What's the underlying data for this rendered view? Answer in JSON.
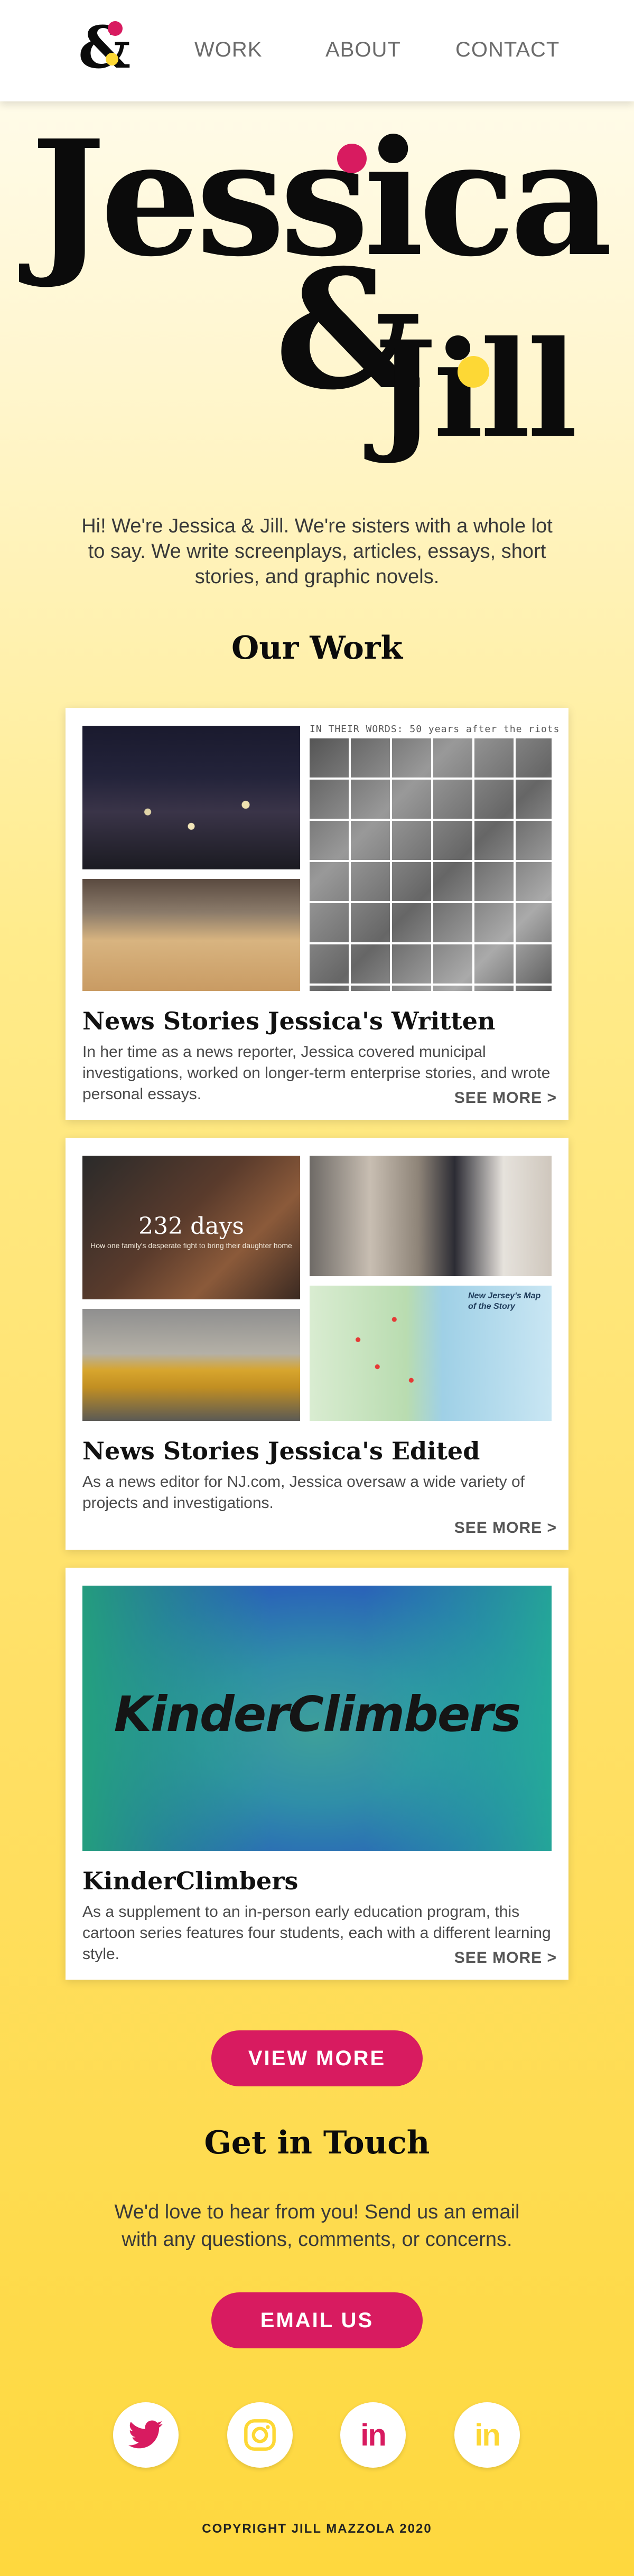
{
  "nav": {
    "logo_alt": "&J",
    "links": [
      "WORK",
      "ABOUT",
      "CONTACT"
    ]
  },
  "hero": {
    "line1": "Jessica",
    "amp": "&",
    "line2": "Jill",
    "intro": "Hi! We're Jessica & Jill. We're sisters with a whole lot to say. We write screenplays, articles, essays, short stories, and graphic novels."
  },
  "our_work": {
    "title": "Our Work",
    "cards": [
      {
        "image_caption": "IN THEIR WORDS: 50 years after the riots",
        "title": "News Stories Jessica's Written",
        "desc": "In her time as a news reporter, Jessica covered municipal investigations, worked on longer-term enterprise stories, and wrote personal essays.",
        "link": "SEE MORE >"
      },
      {
        "image_caption": "232 days",
        "image_subcaption": "How one family's desperate fight to bring their daughter home",
        "map_caption": "New Jersey's Map of the Story",
        "title": "News Stories Jessica's Edited",
        "desc": "As a news editor for NJ.com, Jessica oversaw a wide variety of projects and investigations.",
        "link": "SEE MORE >"
      },
      {
        "image_caption": "KinderClimbers",
        "title": "KinderClimbers",
        "desc": "As a supplement to an in-person early education program, this cartoon series features four students, each with a different learning style.",
        "link": "SEE MORE >"
      }
    ],
    "view_more": "VIEW MORE"
  },
  "contact": {
    "title": "Get in Touch",
    "text": "We'd love to hear from you! Send us an email with any questions, comments, or concerns.",
    "button": "EMAIL US"
  },
  "social": {
    "icons": [
      "twitter-icon",
      "instagram-icon",
      "linkedin-icon",
      "linkedin-icon"
    ],
    "linkedin_label": "in",
    "colors": {
      "pink": "#d81b60",
      "yellow": "#fdd835"
    }
  },
  "footer": {
    "copyright": "COPYRIGHT JILL MAZZOLA 2020"
  }
}
